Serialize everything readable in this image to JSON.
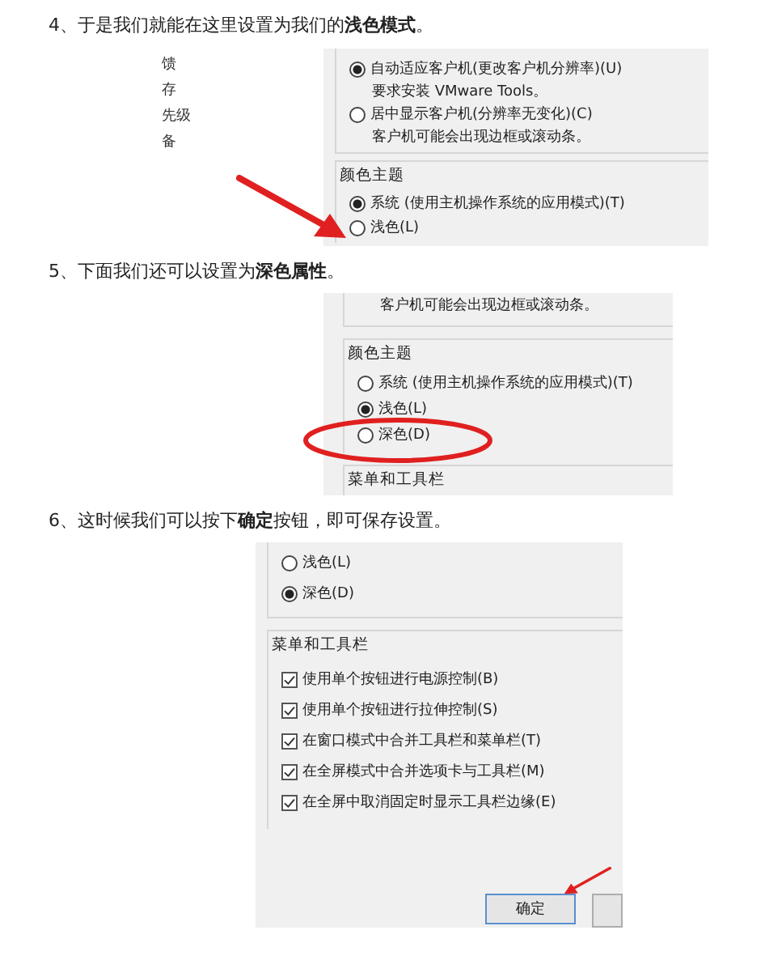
{
  "steps": [
    {
      "text": "4、于是我们就能在这里设置为我们的**浅色模式**。",
      "screenshot": {
        "sidebar": [
          "馈",
          "存",
          "先级",
          "备"
        ],
        "groups": [
          {
            "items": [
              {
                "kind": "radio",
                "text": "自动适应客户机(更改客户机分辨率)(U)",
                "selected": true
              },
              {
                "kind": "note",
                "text": "要求安装 VMware Tools。"
              },
              {
                "kind": "radio",
                "text": "居中显示客户机(分辨率无变化)(C)",
                "selected": false
              },
              {
                "kind": "note",
                "text": "客户机可能会出现边框或滚动条。"
              }
            ]
          },
          {
            "title": "颜色主题",
            "items": [
              {
                "kind": "radio",
                "text": "系统 (使用主机操作系统的应用模式)(T)",
                "selected": true
              },
              {
                "kind": "radio",
                "text": "浅色(L)",
                "selected": false
              }
            ]
          }
        ],
        "annotation": {
          "kind": "arrow"
        }
      }
    },
    {
      "text": "5、下面我们还可以设置为**深色属性**。",
      "screenshot": {
        "groups": [
          {
            "items": [
              {
                "kind": "note",
                "text": "客户机可能会出现边框或滚动条。"
              }
            ]
          },
          {
            "title": "颜色主题",
            "items": [
              {
                "kind": "radio",
                "text": "系统 (使用主机操作系统的应用模式)(T)",
                "selected": false
              },
              {
                "kind": "radio",
                "text": "浅色(L)",
                "selected": true
              },
              {
                "kind": "radio",
                "text": "深色(D)",
                "selected": false
              }
            ]
          },
          {
            "title": "菜单和工具栏"
          }
        ],
        "annotation": {
          "kind": "ellipse"
        }
      }
    },
    {
      "text": "6、这时候我们可以按下**确定**按钮，即可保存设置。",
      "screenshot": {
        "groups": [
          {
            "items": [
              {
                "kind": "radio",
                "text": "浅色(L)",
                "selected": false
              },
              {
                "kind": "radio",
                "text": "深色(D)",
                "selected": true
              }
            ]
          },
          {
            "title": "菜单和工具栏",
            "items": [
              {
                "kind": "checkbox",
                "text": "使用单个按钮进行电源控制(B)",
                "checked": true
              },
              {
                "kind": "checkbox",
                "text": "使用单个按钮进行拉伸控制(S)",
                "checked": true
              },
              {
                "kind": "checkbox",
                "text": "在窗口模式中合并工具栏和菜单栏(T)",
                "checked": true
              },
              {
                "kind": "checkbox",
                "text": "在全屏模式中合并选项卡与工具栏(M)",
                "checked": true
              },
              {
                "kind": "checkbox",
                "text": "在全屏中取消固定时显示工具栏边缘(E)",
                "checked": true
              }
            ]
          }
        ],
        "buttons": [
          "确定"
        ],
        "annotation": {
          "kind": "arrow"
        }
      }
    }
  ]
}
